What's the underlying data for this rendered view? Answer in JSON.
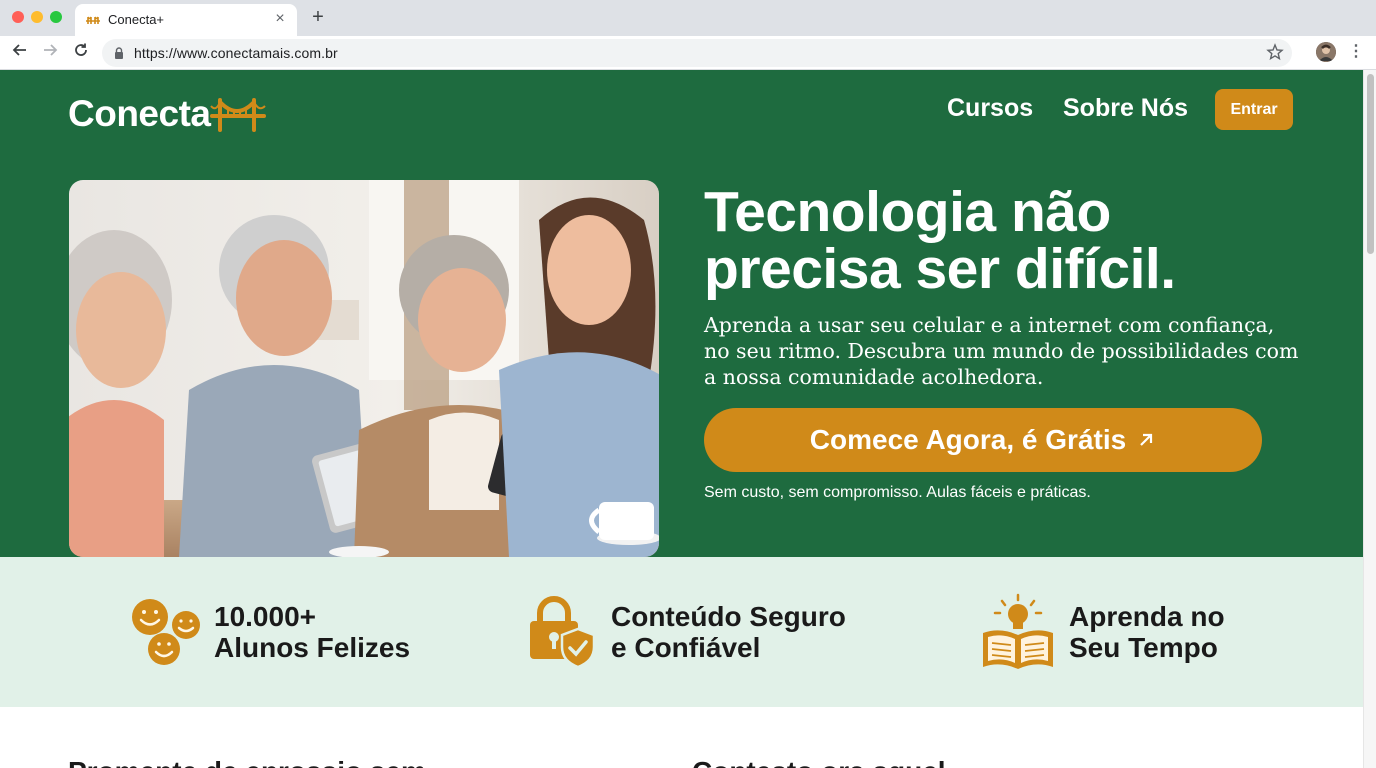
{
  "browser": {
    "tab_title": "Conecta+",
    "url": "https://www.conectamais.com.br",
    "new_tab": "+",
    "close": "×"
  },
  "site": {
    "logo_text": "Conecta",
    "nav": [
      {
        "label": "Cursos"
      },
      {
        "label": "Sobre Nós"
      }
    ],
    "login_label": "Entrar",
    "colors": {
      "brand_green": "#1e6b3f",
      "accent_gold": "#d08a19",
      "band_mint": "#e1f1e8"
    }
  },
  "hero": {
    "title_line1": "Tecnologia não",
    "title_line2": "precisa ser difícil.",
    "subtitle": "Aprenda a usar seu celular e a internet com confiança, no seu ritmo. Descubra um mundo de possibilidades com a nossa comunidade acolhedora.",
    "cta_label": "Comece Agora, é Grátis",
    "cta_icon": "arrow-up-right-icon",
    "cta_note": "Sem custo, sem compromisso. Aulas fáceis e práticas."
  },
  "features": [
    {
      "line1": "10.000+",
      "line2": "Alunos Felizes",
      "icon": "smiley-faces-icon"
    },
    {
      "line1": "Conteúdo Seguro",
      "line2": "e Confiável",
      "icon": "lock-shield-icon"
    },
    {
      "line1": "Aprenda no",
      "line2": "Seu Tempo",
      "icon": "book-lightbulb-icon"
    }
  ],
  "sections": {
    "left_heading": "Promente de enrossio sem",
    "right_heading": "Contesto ora squel"
  }
}
